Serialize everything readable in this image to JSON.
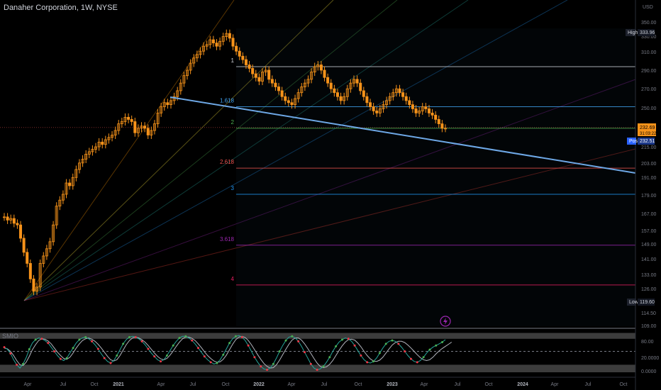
{
  "header": {
    "title": "Danaher Corporation, 1W, NYSE"
  },
  "oscillator": {
    "label": "SMIO"
  },
  "axis": {
    "currency": "USD",
    "price_ticks": [
      "350.00",
      "330.00",
      "310.00",
      "290.00",
      "270.00",
      "250.00",
      "215.00",
      "203.00",
      "191.00",
      "179.00",
      "167.00",
      "157.00",
      "149.00",
      "141.00",
      "133.00",
      "126.00",
      "114.50",
      "109.00"
    ],
    "osc_ticks": [
      "80.00",
      "20.0000",
      "0.0000"
    ],
    "time_ticks": [
      "Apr",
      "Jul",
      "Oct",
      "2021",
      "Apr",
      "Jul",
      "Oct",
      "2022",
      "Apr",
      "Jul",
      "Oct",
      "2023",
      "Apr",
      "Jul",
      "Oct",
      "2024",
      "Apr",
      "Jul",
      "Oct"
    ]
  },
  "badges": {
    "high_label": "High",
    "high_value": "333.96",
    "last_value": "232.69",
    "countdown": "31:03:22",
    "post_label": "Post",
    "post_value": "232.51",
    "low_label": "Low",
    "low_value": "119.60"
  },
  "fib_levels": [
    {
      "label": "1",
      "color": "#d1d4dc"
    },
    {
      "label": "1.618",
      "color": "#42a5f5"
    },
    {
      "label": "2",
      "color": "#4caf50"
    },
    {
      "label": "2.618",
      "color": "#ef5350"
    },
    {
      "label": "3",
      "color": "#2196f3"
    },
    {
      "label": "3.618",
      "color": "#9c27b0"
    },
    {
      "label": "4",
      "color": "#e91e63"
    }
  ],
  "colors": {
    "candle": "#f7931a",
    "trendline": "#6ea8e6",
    "osc_k": "#26a69a",
    "osc_d": "#b2b5be",
    "osc_dot_up": "#4caf50",
    "osc_dot_down": "#f23645"
  },
  "chart_data": {
    "type": "candlestick",
    "title": "Danaher Corporation, 1W, NYSE",
    "ylabel": "USD",
    "ylim": [
      109,
      350
    ],
    "x_ticks": [
      "Apr",
      "Jul",
      "Oct",
      "2021",
      "Apr",
      "Jul",
      "Oct",
      "2022",
      "Apr",
      "Jul",
      "Oct",
      "2023",
      "Apr",
      "Jul",
      "Oct",
      "2024",
      "Apr",
      "Jul",
      "Oct"
    ],
    "y_ticks": [
      350,
      330,
      310,
      290,
      270,
      250,
      215,
      203,
      191,
      179,
      167,
      157,
      149,
      141,
      133,
      126,
      114.5,
      109
    ],
    "closes": [
      165,
      163,
      164,
      161,
      160,
      152,
      144,
      138,
      130,
      124,
      126,
      138,
      142,
      146,
      150,
      160,
      172,
      176,
      180,
      188,
      186,
      192,
      198,
      203,
      206,
      210,
      212,
      214,
      216,
      220,
      218,
      222,
      224,
      226,
      230,
      236,
      238,
      242,
      240,
      238,
      228,
      232,
      234,
      232,
      226,
      230,
      236,
      246,
      252,
      256,
      254,
      258,
      262,
      268,
      276,
      284,
      290,
      298,
      304,
      308,
      312,
      318,
      320,
      326,
      322,
      318,
      324,
      330,
      334,
      328,
      318,
      312,
      306,
      302,
      296,
      292,
      286,
      282,
      278,
      288,
      290,
      280,
      276,
      272,
      268,
      262,
      258,
      256,
      254,
      260,
      266,
      272,
      276,
      280,
      288,
      294,
      296,
      290,
      282,
      276,
      270,
      266,
      262,
      258,
      262,
      270,
      276,
      280,
      276,
      268,
      262,
      256,
      252,
      248,
      246,
      250,
      254,
      258,
      262,
      266,
      270,
      266,
      262,
      258,
      254,
      250,
      246,
      248,
      252,
      250,
      246,
      244,
      240,
      236,
      232,
      232
    ],
    "high": 333.96,
    "low": 119.6,
    "last": 232.69,
    "post_market": 232.51,
    "fib_levels": [
      {
        "level": "1",
        "price": 294
      },
      {
        "level": "1.618",
        "price": 252
      },
      {
        "level": "2",
        "price": 232
      },
      {
        "level": "2.618",
        "price": 199
      },
      {
        "level": "3",
        "price": 180
      },
      {
        "level": "3.618",
        "price": 148
      },
      {
        "level": "4",
        "price": 127
      }
    ],
    "oscillator": {
      "name": "SMIO",
      "ylim": [
        0,
        100
      ],
      "levels": [
        80,
        20,
        0
      ],
      "k": [
        60,
        55,
        45,
        30,
        18,
        10,
        20,
        35,
        55,
        70,
        78,
        82,
        80,
        76,
        70,
        60,
        50,
        40,
        32,
        28,
        34,
        46,
        58,
        70,
        78,
        82,
        84,
        80,
        74,
        66,
        56,
        44,
        34,
        26,
        22,
        28,
        40,
        54,
        68,
        78,
        84,
        86,
        84,
        80,
        74,
        66,
        56,
        46,
        38,
        30,
        26,
        30,
        40,
        52,
        64,
        74,
        82,
        86,
        86,
        82,
        76,
        68,
        58,
        48,
        38,
        30,
        24,
        20,
        22,
        30,
        42,
        56,
        70,
        80,
        86,
        88,
        84,
        76,
        64,
        50,
        36,
        24,
        14,
        8,
        6,
        10,
        20,
        34,
        50,
        64,
        76,
        84,
        86,
        82,
        74,
        62,
        48,
        34,
        20,
        10,
        6,
        8,
        14,
        24,
        36,
        50,
        62,
        72,
        78,
        82,
        80,
        74,
        64,
        52,
        40,
        30,
        24,
        22,
        26,
        34,
        46,
        58,
        68,
        74,
        76,
        74,
        68,
        60,
        50,
        40,
        32,
        26,
        24,
        28,
        36,
        46,
        54,
        60,
        64,
        68,
        72,
        78
      ],
      "d": [
        58,
        56,
        50,
        40,
        28,
        18,
        16,
        24,
        38,
        54,
        66,
        76,
        80,
        79,
        75,
        68,
        58,
        48,
        40,
        33,
        31,
        36,
        46,
        58,
        68,
        76,
        80,
        82,
        79,
        74,
        67,
        58,
        48,
        38,
        30,
        27,
        30,
        40,
        53,
        66,
        76,
        82,
        84,
        82,
        78,
        72,
        64,
        55,
        46,
        38,
        32,
        30,
        33,
        41,
        51,
        62,
        72,
        80,
        84,
        84,
        81,
        76,
        68,
        59,
        49,
        40,
        33,
        27,
        24,
        25,
        31,
        41,
        54,
        67,
        78,
        84,
        86,
        83,
        76,
        66,
        54,
        42,
        31,
        21,
        14,
        10,
        11,
        18,
        29,
        42,
        55,
        67,
        77,
        82,
        82,
        77,
        68,
        57,
        45,
        33,
        22,
        14,
        11,
        13,
        19,
        28,
        40,
        52,
        63,
        72,
        78,
        79,
        77,
        70,
        61,
        50,
        40,
        32,
        27,
        26,
        29,
        36,
        46,
        56,
        65,
        71,
        74,
        74,
        71,
        65,
        58,
        50,
        42,
        35,
        30,
        28,
        30,
        36,
        44,
        51,
        57,
        62,
        67,
        72
      ]
    }
  }
}
